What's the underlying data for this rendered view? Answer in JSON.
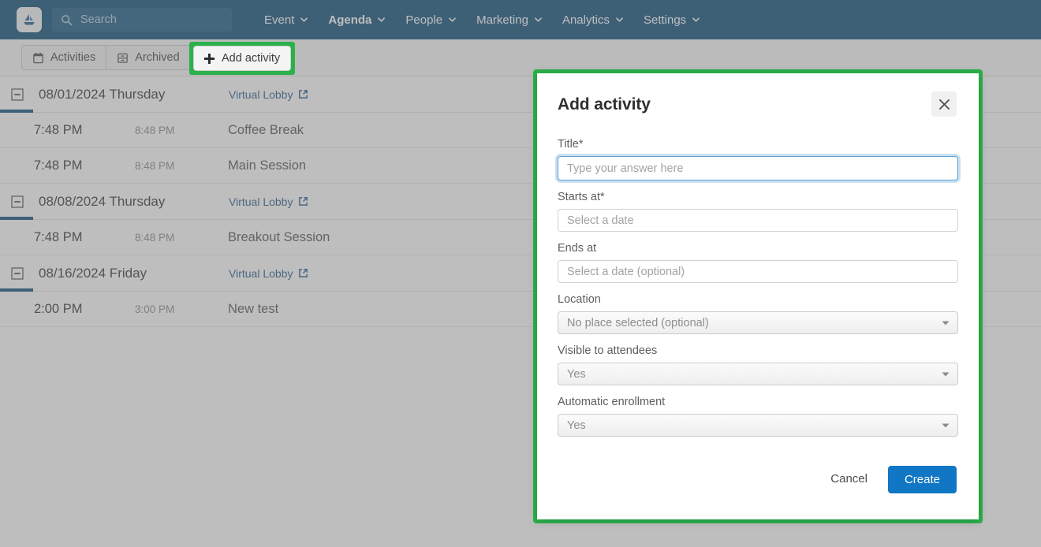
{
  "navbar": {
    "logo_icon": "sailboat-logo-icon",
    "search": {
      "placeholder": "Search",
      "value": "",
      "icon": "search-icon"
    },
    "items": [
      {
        "label": "Event",
        "active": false
      },
      {
        "label": "Agenda",
        "active": true
      },
      {
        "label": "People",
        "active": false
      },
      {
        "label": "Marketing",
        "active": false
      },
      {
        "label": "Analytics",
        "active": false
      },
      {
        "label": "Settings",
        "active": false
      }
    ],
    "background": "#15557f"
  },
  "toolbar": {
    "tabs": [
      {
        "label": "Activities",
        "icon": "calendar-icon"
      },
      {
        "label": "Archived",
        "icon": "archive-icon"
      }
    ],
    "add_activity_label": "Add activity",
    "add_activity_icon": "plus-icon",
    "highlight_color": "#2bb14b"
  },
  "agenda": {
    "lobby_link_label": "Virtual Lobby",
    "lobby_link_icon": "external-link-icon",
    "collapse_icon": "minus-square-icon",
    "days": [
      {
        "date": "08/01/2024 Thursday",
        "activities": [
          {
            "start": "7:48 PM",
            "end": "8:48 PM",
            "title": "Coffee Break"
          },
          {
            "start": "7:48 PM",
            "end": "8:48 PM",
            "title": "Main Session"
          }
        ]
      },
      {
        "date": "08/08/2024 Thursday",
        "activities": [
          {
            "start": "7:48 PM",
            "end": "8:48 PM",
            "title": "Breakout Session"
          }
        ]
      },
      {
        "date": "08/16/2024 Friday",
        "activities": [
          {
            "start": "2:00 PM",
            "end": "3:00 PM",
            "title": "New test"
          }
        ]
      }
    ]
  },
  "modal": {
    "title": "Add activity",
    "close_icon": "close-icon",
    "fields": [
      {
        "label": "Title*",
        "kind": "text",
        "value": "",
        "placeholder": "Type your answer here",
        "focused": true
      },
      {
        "label": "Starts at*",
        "kind": "text",
        "value": "",
        "placeholder": "Select a date",
        "focused": false
      },
      {
        "label": "Ends at",
        "kind": "text",
        "value": "",
        "placeholder": "Select a date (optional)",
        "focused": false
      },
      {
        "label": "Location",
        "kind": "select",
        "value": "No place selected (optional)"
      },
      {
        "label": "Visible to attendees",
        "kind": "select",
        "value": "Yes"
      },
      {
        "label": "Automatic enrollment",
        "kind": "select",
        "value": "Yes"
      }
    ],
    "cancel_label": "Cancel",
    "create_label": "Create",
    "create_color": "#1177c4"
  }
}
